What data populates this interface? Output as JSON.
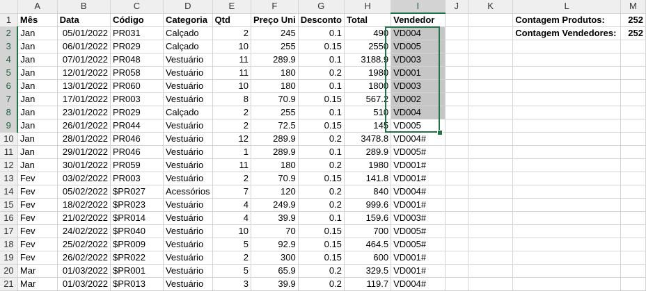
{
  "columns": [
    "A",
    "B",
    "C",
    "D",
    "E",
    "F",
    "G",
    "H",
    "I",
    "J",
    "K",
    "L",
    "M"
  ],
  "selected_column": "I",
  "rows": [
    {
      "n": "1",
      "cells": [
        "Mês",
        "Data",
        "Código",
        "Categoria",
        "Qtd",
        "Preço Uni",
        "Desconto",
        "Total",
        "Vendedor",
        "",
        "",
        "Contagem Produtos:",
        "252"
      ]
    },
    {
      "n": "2",
      "cells": [
        "Jan",
        "05/01/2022",
        "PR031",
        "Calçado",
        "2",
        "245",
        "0.1",
        "490",
        "VD004",
        "",
        "",
        "Contagem Vendedores:",
        "252"
      ]
    },
    {
      "n": "3",
      "cells": [
        "Jan",
        "06/01/2022",
        "PR029",
        "Calçado",
        "10",
        "255",
        "0.15",
        "2550",
        "VD005",
        "",
        "",
        "",
        ""
      ]
    },
    {
      "n": "4",
      "cells": [
        "Jan",
        "07/01/2022",
        "PR048",
        "Vestuário",
        "11",
        "289.9",
        "0.1",
        "3188.9",
        "VD003",
        "",
        "",
        "",
        ""
      ]
    },
    {
      "n": "5",
      "cells": [
        "Jan",
        "12/01/2022",
        "PR058",
        "Vestuário",
        "11",
        "180",
        "0.2",
        "1980",
        "VD001",
        "",
        "",
        "",
        ""
      ]
    },
    {
      "n": "6",
      "cells": [
        "Jan",
        "13/01/2022",
        "PR060",
        "Vestuário",
        "10",
        "180",
        "0.1",
        "1800",
        "VD003",
        "",
        "",
        "",
        ""
      ]
    },
    {
      "n": "7",
      "cells": [
        "Jan",
        "17/01/2022",
        "PR003",
        "Vestuário",
        "8",
        "70.9",
        "0.15",
        "567.2",
        "VD002",
        "",
        "",
        "",
        ""
      ]
    },
    {
      "n": "8",
      "cells": [
        "Jan",
        "23/01/2022",
        "PR029",
        "Calçado",
        "2",
        "255",
        "0.1",
        "510",
        "VD004",
        "",
        "",
        "",
        ""
      ]
    },
    {
      "n": "9",
      "cells": [
        "Jan",
        "26/01/2022",
        "PR044",
        "Vestuário",
        "2",
        "72.5",
        "0.15",
        "145",
        "VD005",
        "",
        "",
        "",
        ""
      ]
    },
    {
      "n": "10",
      "cells": [
        "Jan",
        "28/01/2022",
        "PR046",
        "Vestuário",
        "12",
        "289.9",
        "0.2",
        "3478.8",
        "VD004#",
        "",
        "",
        "",
        ""
      ]
    },
    {
      "n": "11",
      "cells": [
        "Jan",
        "29/01/2022",
        "PR046",
        "Vestuário",
        "1",
        "289.9",
        "0.1",
        "289.9",
        "VD005#",
        "",
        "",
        "",
        ""
      ]
    },
    {
      "n": "12",
      "cells": [
        "Jan",
        "30/01/2022",
        "PR059",
        "Vestuário",
        "11",
        "180",
        "0.2",
        "1980",
        "VD001#",
        "",
        "",
        "",
        ""
      ]
    },
    {
      "n": "13",
      "cells": [
        "Fev",
        "03/02/2022",
        "PR003",
        "Vestuário",
        "2",
        "70.9",
        "0.15",
        "141.8",
        "VD001#",
        "",
        "",
        "",
        ""
      ]
    },
    {
      "n": "14",
      "cells": [
        "Fev",
        "05/02/2022",
        "$PR027",
        "Acessórios",
        "7",
        "120",
        "0.2",
        "840",
        "VD004#",
        "",
        "",
        "",
        ""
      ]
    },
    {
      "n": "15",
      "cells": [
        "Fev",
        "18/02/2022",
        "$PR023",
        "Vestuário",
        "4",
        "249.9",
        "0.2",
        "999.6",
        "VD001#",
        "",
        "",
        "",
        ""
      ]
    },
    {
      "n": "16",
      "cells": [
        "Fev",
        "21/02/2022",
        "$PR014",
        "Vestuário",
        "4",
        "39.9",
        "0.1",
        "159.6",
        "VD003#",
        "",
        "",
        "",
        ""
      ]
    },
    {
      "n": "17",
      "cells": [
        "Fev",
        "24/02/2022",
        "$PR040",
        "Vestuário",
        "10",
        "70",
        "0.15",
        "700",
        "VD005#",
        "",
        "",
        "",
        ""
      ]
    },
    {
      "n": "18",
      "cells": [
        "Fev",
        "25/02/2022",
        "$PR009",
        "Vestuário",
        "5",
        "92.9",
        "0.15",
        "464.5",
        "VD005#",
        "",
        "",
        "",
        ""
      ]
    },
    {
      "n": "19",
      "cells": [
        "Fev",
        "26/02/2022",
        "$PR022",
        "Vestuário",
        "2",
        "300",
        "0.15",
        "600",
        "VD001#",
        "",
        "",
        "",
        ""
      ]
    },
    {
      "n": "20",
      "cells": [
        "Mar",
        "01/03/2022",
        "$PR001",
        "Vestuário",
        "5",
        "65.9",
        "0.2",
        "329.5",
        "VD001#",
        "",
        "",
        "",
        ""
      ]
    },
    {
      "n": "21",
      "cells": [
        "Mar",
        "01/03/2022",
        "$PR013",
        "Vestuário",
        "3",
        "39.9",
        "0.2",
        "119.7",
        "VD004#",
        "",
        "",
        "",
        ""
      ]
    }
  ]
}
